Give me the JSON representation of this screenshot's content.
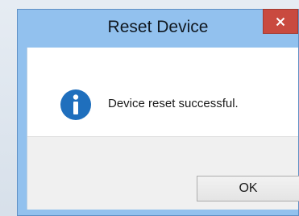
{
  "dialog": {
    "title": "Reset Device",
    "message": "Device reset successful.",
    "icon": "info-icon",
    "ok_label": "OK",
    "close_icon": "close-icon"
  },
  "colors": {
    "titlebar": "#92c1ee",
    "close_button": "#c94a3f",
    "info_icon": "#1f6fbd",
    "footer": "#f0f0f0"
  }
}
